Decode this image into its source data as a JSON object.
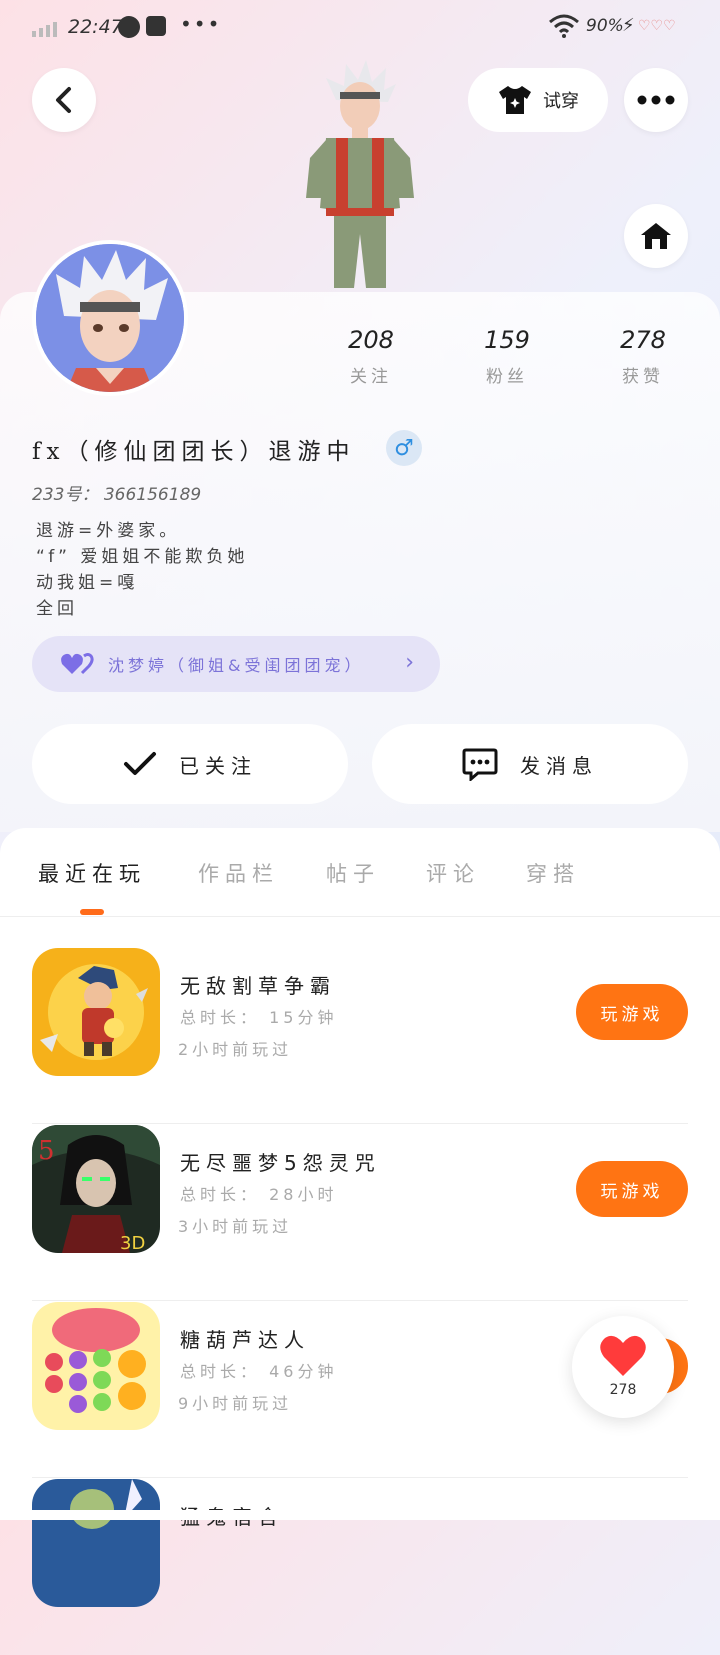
{
  "status": {
    "time": "22:47",
    "battery": "90%"
  },
  "header": {
    "try_on": "试穿"
  },
  "stats": [
    {
      "num": "208",
      "label": "关注"
    },
    {
      "num": "159",
      "label": "粉丝"
    },
    {
      "num": "278",
      "label": "获赞"
    }
  ],
  "profile": {
    "name": "fx（修仙团团长）退游中",
    "gender": "♂",
    "uid": "233号： 366156189",
    "bio": [
      "退游=外婆家。",
      "“f” 爱姐姐不能欺负她",
      "动我姐=嘎",
      "全回"
    ],
    "guild": "沈梦婷（御姐&受闺团团宠）"
  },
  "actions": {
    "following": "已关注",
    "message": "发消息"
  },
  "tabs": [
    "最近在玩",
    "作品栏",
    "帖子",
    "评论",
    "穿搭"
  ],
  "games": [
    {
      "title": "无敌割草争霸",
      "duration": "总时长： 15分钟",
      "last_played": "2小时前玩过",
      "button": "玩游戏"
    },
    {
      "title": "无尽噩梦5怨灵咒",
      "duration": "总时长： 28小时",
      "last_played": "3小时前玩过",
      "button": "玩游戏"
    },
    {
      "title": "糖葫芦达人",
      "duration": "总时长： 46分钟",
      "last_played": "9小时前玩过",
      "button": ""
    },
    {
      "title": "猛鬼宿舍",
      "duration": "",
      "last_played": "",
      "button": ""
    }
  ],
  "like_bubble": {
    "count": "278"
  },
  "colors": {
    "accent": "#ff7413",
    "guild_text": "#7c73d8",
    "gender": "#2f8fe0"
  }
}
